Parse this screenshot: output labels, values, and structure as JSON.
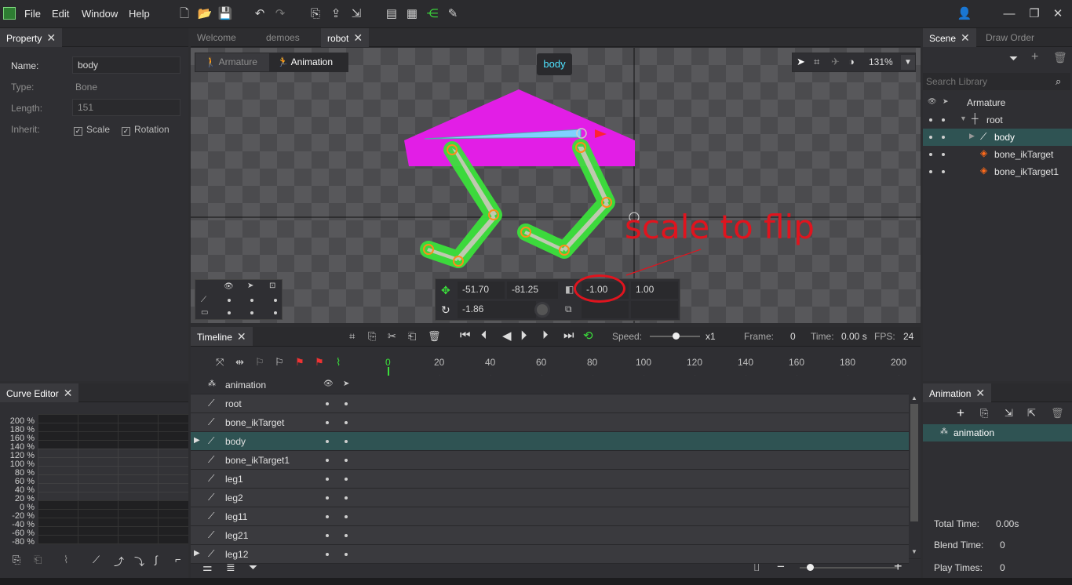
{
  "menu": {
    "file": "File",
    "edit": "Edit",
    "window": "Window",
    "help": "Help"
  },
  "toolbar": {
    "icons": [
      "new-file-icon",
      "open-folder-icon",
      "save-icon",
      "undo-icon",
      "redo-icon",
      "import-icon",
      "export-icon",
      "export-folder-icon",
      "publish-icon",
      "publish-atlas-icon",
      "share-icon",
      "edit-icon"
    ]
  },
  "property": {
    "title": "Property",
    "name_label": "Name:",
    "name_value": "body",
    "type_label": "Type:",
    "type_value": "Bone",
    "length_label": "Length:",
    "length_value": "151",
    "inherit_label": "Inherit:",
    "scale_label": "Scale",
    "rotation_label": "Rotation"
  },
  "editor_tabs": {
    "welcome": "Welcome",
    "demoes": "demoes",
    "robot": "robot"
  },
  "viewport": {
    "armature_mode": "Armature",
    "animation_mode": "Animation",
    "selected_bone": "body",
    "zoom": "131%",
    "annotation": "scale to flip"
  },
  "transform": {
    "x": "-51.70",
    "y": "-81.25",
    "scale_x": "-1.00",
    "scale_y": "1.00",
    "rotation": "-1.86"
  },
  "scene": {
    "title": "Scene",
    "draw_order": "Draw Order",
    "search_placeholder": "Search Library",
    "items": {
      "armature": "Armature",
      "root": "root",
      "body": "body",
      "ik1": "bone_ikTarget",
      "ik2": "bone_ikTarget1"
    }
  },
  "timeline": {
    "title": "Timeline",
    "speed_label": "Speed:",
    "speed_value": "x1",
    "frame_label": "Frame:",
    "frame_value": "0",
    "time_label": "Time:",
    "time_value": "0.00 s",
    "fps_label": "FPS:",
    "fps_value": "24",
    "ticks": [
      "0",
      "20",
      "40",
      "60",
      "80",
      "100",
      "120",
      "140",
      "160",
      "180",
      "200"
    ],
    "rows": [
      "animation",
      "root",
      "bone_ikTarget",
      "body",
      "bone_ikTarget1",
      "leg1",
      "leg2",
      "leg11",
      "leg21",
      "leg12"
    ]
  },
  "curve": {
    "title": "Curve Editor",
    "percents": [
      "200 %",
      "180 %",
      "160 %",
      "140 %",
      "120 %",
      "100 %",
      "80 %",
      "60 %",
      "40 %",
      "20 %",
      "0 %",
      "-20 %",
      "-40 %",
      "-60 %",
      "-80 %"
    ]
  },
  "animation_panel": {
    "title": "Animation",
    "item": "animation",
    "total_time_label": "Total Time:",
    "total_time_value": "0.00s",
    "blend_time_label": "Blend Time:",
    "blend_time_value": "0",
    "play_times_label": "Play Times:",
    "play_times_value": "0"
  },
  "colors": {
    "accent_green": "#3be03b",
    "body_magenta": "#e21ee6",
    "selection_teal": "#2f5353",
    "annotation_red": "#e0141e"
  }
}
